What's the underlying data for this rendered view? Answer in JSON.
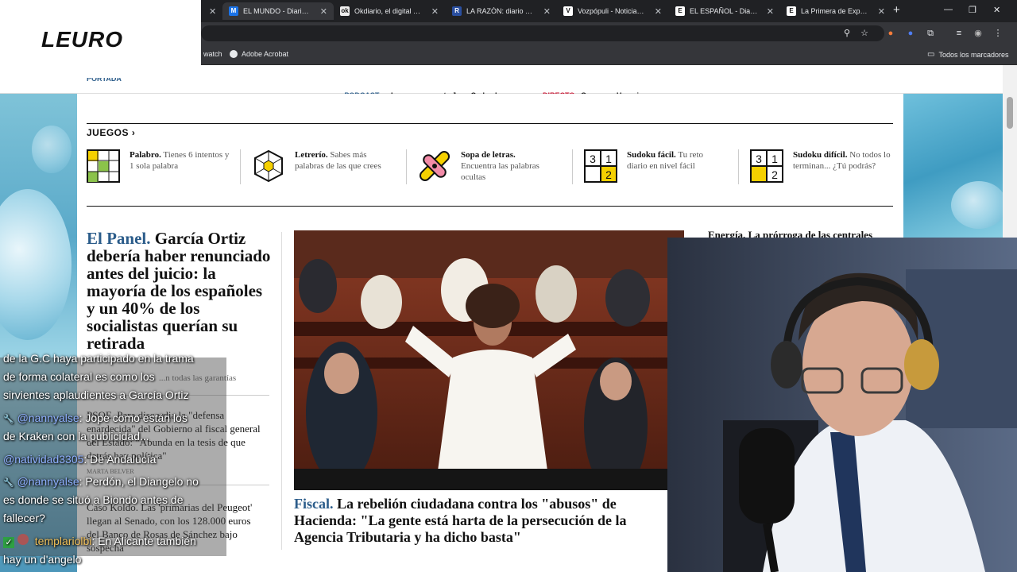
{
  "browser": {
    "tabs": [
      {
        "label": "EL MUNDO - Diario onlin",
        "active": true,
        "color": "#1a73e8",
        "glyph": "M"
      },
      {
        "label": "Okdiario, el digital de Edu",
        "active": false,
        "color": "#f5f5f5",
        "glyph": "ok"
      },
      {
        "label": "LA RAZÓN: diario de noti",
        "active": false,
        "color": "#2a4fa0",
        "glyph": "R"
      },
      {
        "label": "Vozpópuli - Noticias de ú",
        "active": false,
        "color": "#ffffff",
        "glyph": "V"
      },
      {
        "label": "EL ESPAÑOL - Diario digi",
        "active": false,
        "color": "#ffffff",
        "glyph": "E"
      },
      {
        "label": "La Primera de Expansión",
        "active": false,
        "color": "#ffffff",
        "glyph": "E"
      }
    ],
    "bookmarks": [
      "watch",
      "Adobe Acrobat"
    ],
    "all_bookmarks": "Todos los marcadores"
  },
  "overlay": {
    "logo": "LEURO"
  },
  "site": {
    "top_strip": {
      "podcast_label": "PODCAST",
      "podcast_text": "Lo que no cuenta Juan Carlos I",
      "directo_label": "DIRECTO",
      "directo_text": "Guerra en Ucrania",
      "cut_label": "PORTADA"
    },
    "juegos_title": "JUEGOS",
    "games": [
      {
        "name": "Palabro.",
        "desc": "Tienes 6 intentos y 1 sola palabra",
        "icon": "palabro-grid-icon"
      },
      {
        "name": "Letrerío.",
        "desc": "Sabes más palabras de las que crees",
        "icon": "letrerio-hexagon-icon"
      },
      {
        "name": "Sopa de letras.",
        "desc": "Encuentra las palabras ocultas",
        "icon": "sopa-de-letras-icon"
      },
      {
        "name": "Sudoku fácil.",
        "desc": "Tu reto diario en nivel fácil",
        "icon": "sudoku-icon"
      },
      {
        "name": "Sudoku difícil.",
        "desc": "No todos lo terminan... ¿Tú podrás?",
        "icon": "sudoku-icon"
      }
    ],
    "sudoku_digits": [
      "3",
      "1",
      "2"
    ],
    "panel": {
      "kicker": "El Panel.",
      "headline": "García Ortiz debería haber renunciado antes del juicio: la mayoría de los españoles y un 40% de los socialistas querían su retirada",
      "subline": "...n todas las garantías"
    },
    "side_stories": [
      {
        "text": "PSOE. Para discordia la \"defensa enardecida\" del Gobierno al fiscal general del Estado: \"Abunda en la tesis de que detrás hay política\"",
        "author": "MARTA BELVER"
      },
      {
        "text": "Caso Koldo. Las 'primarias del Peugeot' llegan al Senado, con los 128.000 euros del Banco de Rosas de Sánchez bajo sospecha",
        "author": ""
      }
    ],
    "hero": {
      "kicker": "Fiscal.",
      "headline": "La rebelión ciudadana contra los \"abusos\" de Hacienda: \"La gente está harta de la persecución de la Agencia Tributaria y ha dicho basta\""
    },
    "right_story": "Energía. La prórroga de las centrales"
  },
  "chat": [
    {
      "user": "",
      "text": "de la G.C haya participado en la trama",
      "badge": ""
    },
    {
      "user": "",
      "text": "de forma colateral es como los",
      "badge": ""
    },
    {
      "user": "",
      "text": "sirvientes aplaudientes a García Ortiz",
      "badge": ""
    },
    {
      "user": "@nannyalse",
      "text": ": Jope como están los",
      "badge": "wrench"
    },
    {
      "user": "",
      "text": "de Kraken con la publicidad...",
      "badge": ""
    },
    {
      "user": "@natividad3305",
      "text": ": De Andalucía",
      "badge": ""
    },
    {
      "user": "@nannyalse",
      "text": ": Perdón, el Diangelo no",
      "badge": "wrench"
    },
    {
      "user": "",
      "text": "es donde se situó a Biondo antes de",
      "badge": ""
    },
    {
      "user": "",
      "text": "fallecer?",
      "badge": ""
    },
    {
      "user": "templariolbi",
      "text": ": En Alicante también",
      "badge": "check"
    },
    {
      "user": "",
      "text": "hay un d'angelo",
      "badge": ""
    }
  ],
  "colors": {
    "kicker_blue": "#2b5c8a",
    "chat_user": "#8fb0ff",
    "chat_user_gold": "#f0c05a"
  }
}
